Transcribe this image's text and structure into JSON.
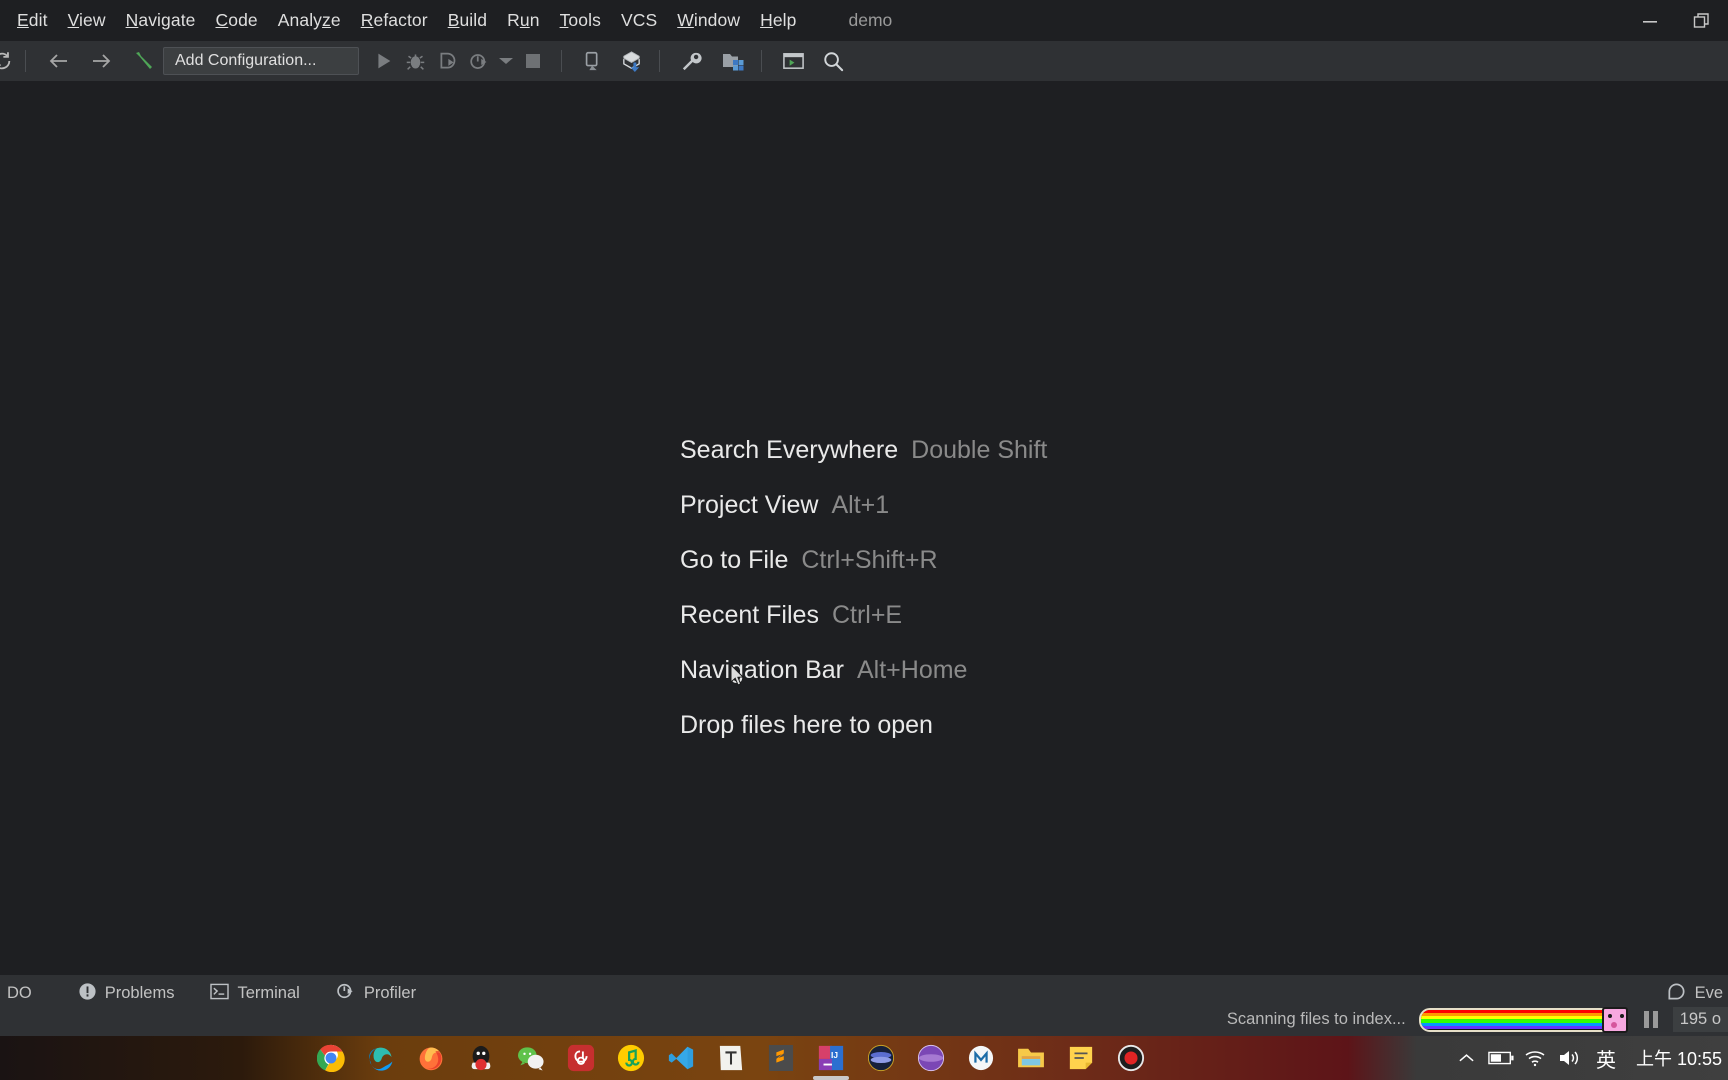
{
  "window": {
    "project_title": "demo",
    "minimize_label": "Minimize",
    "restore_label": "Restore"
  },
  "menubar": {
    "items": [
      {
        "label": "Edit",
        "mnemonic": "E"
      },
      {
        "label": "View",
        "mnemonic": "V"
      },
      {
        "label": "Navigate",
        "mnemonic": "N"
      },
      {
        "label": "Code",
        "mnemonic": "C"
      },
      {
        "label": "Analyze",
        "mnemonic": "z"
      },
      {
        "label": "Refactor",
        "mnemonic": "R"
      },
      {
        "label": "Build",
        "mnemonic": "B"
      },
      {
        "label": "Run",
        "mnemonic": "u"
      },
      {
        "label": "Tools",
        "mnemonic": "T"
      },
      {
        "label": "VCS",
        "mnemonic": ""
      },
      {
        "label": "Window",
        "mnemonic": "W"
      },
      {
        "label": "Help",
        "mnemonic": "H"
      }
    ]
  },
  "toolbar": {
    "sync_label": "Sync / Refresh",
    "back_label": "Back",
    "forward_label": "Forward",
    "build_label": "Build Project",
    "run_config_label": "Add Configuration...",
    "run_label": "Run",
    "debug_label": "Debug",
    "run_coverage_label": "Run with Coverage",
    "profile_label": "Profile",
    "profile_dropdown_label": "More Run/Debug",
    "stop_label": "Stop",
    "attach_label": "Attach to Process",
    "update_project_label": "Update Project",
    "settings_label": "Settings",
    "project_structure_label": "Project Structure",
    "terminal_label": "Terminal",
    "search_label": "Search Everywhere"
  },
  "editor": {
    "shortcuts": [
      {
        "name": "Search Everywhere",
        "keys": "Double Shift"
      },
      {
        "name": "Project View",
        "keys": "Alt+1"
      },
      {
        "name": "Go to File",
        "keys": "Ctrl+Shift+R"
      },
      {
        "name": "Recent Files",
        "keys": "Ctrl+E"
      },
      {
        "name": "Navigation Bar",
        "keys": "Alt+Home"
      }
    ],
    "drop_hint": "Drop files here to open"
  },
  "statusbar": {
    "todo_label": "DO",
    "problems_label": "Problems",
    "terminal_label": "Terminal",
    "profiler_label": "Profiler",
    "event_log_label": "Eve"
  },
  "progress": {
    "scanning_text": "Scanning files to index...",
    "pause_label": "Pause",
    "memory_label": "195 o",
    "bar_colors": [
      "#ff0000",
      "#ff9900",
      "#ffff00",
      "#33ff00",
      "#0099ff",
      "#6633ff"
    ]
  },
  "taskbar": {
    "apps": [
      {
        "name": "google-chrome",
        "title": "Google Chrome"
      },
      {
        "name": "microsoft-edge",
        "title": "Microsoft Edge"
      },
      {
        "name": "firefox",
        "title": "Mozilla Firefox"
      },
      {
        "name": "qq",
        "title": "QQ"
      },
      {
        "name": "wechat",
        "title": "WeChat"
      },
      {
        "name": "netease-music",
        "title": "NetEase Cloud Music"
      },
      {
        "name": "qq-music",
        "title": "QQ Music"
      },
      {
        "name": "vscode",
        "title": "Visual Studio Code"
      },
      {
        "name": "typora",
        "title": "Typora"
      },
      {
        "name": "sublime-text",
        "title": "Sublime Text"
      },
      {
        "name": "intellij-idea",
        "title": "IntelliJ IDEA",
        "active": true
      },
      {
        "name": "navicat",
        "title": "Navicat"
      },
      {
        "name": "purple-app",
        "title": "Media Player"
      },
      {
        "name": "maven-app",
        "title": "Application"
      },
      {
        "name": "file-explorer",
        "title": "File Explorer"
      },
      {
        "name": "notepad",
        "title": "Notepad"
      },
      {
        "name": "recorder",
        "title": "Screen Recorder"
      }
    ],
    "tray": {
      "show_hidden_label": "Show hidden icons",
      "battery_label": "Battery",
      "network_label": "Network",
      "volume_label": "Volume",
      "ime_label": "英",
      "clock": "上午 10:55"
    }
  }
}
